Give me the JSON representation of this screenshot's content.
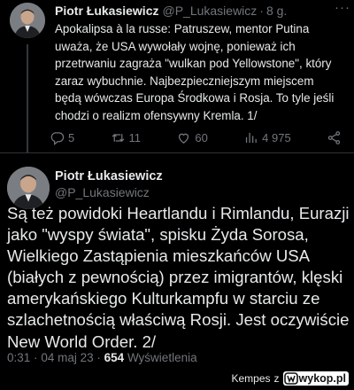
{
  "tweet1": {
    "author_name": "Piotr Łukasiewicz",
    "handle": "@P_Lukasiewicz",
    "separator": "·",
    "time": "8 g.",
    "text": "Apokalipsa à la russe: Patruszew, mentor Putina\nuważa, że USA wywołały wojnę, ponieważ ich\nprzetrwaniu zagraża \"wulkan pod Yellowstone\", który\nzaraz wybuchnie. Najbezpieczniejszym miejscem\nbędą wówczas Europa Środkowa i Rosja. To tyle jeśli\nchodzi o realizm ofensywny Kremla. 1/",
    "replies": "5",
    "retweets": "11",
    "likes": "60",
    "views": "4 975",
    "icons": [
      "reply-icon",
      "retweet-icon",
      "like-icon",
      "views-icon",
      "share-icon",
      "more-icon"
    ]
  },
  "tweet2": {
    "author_name": "Piotr Łukasiewicz",
    "handle": "@P_Lukasiewicz",
    "text": "Są też powidoki Heartlandu i Rimlandu, Eurazji\njako \"wyspy świata\", spisku Żyda Sorosa,\nWielkiego Zastąpienia mieszkańców USA\n(białych z pewnością) przez imigrantów, klęski\namerykańskiego Kulturkampfu w starciu ze\nszlachetnością właściwą Rosji. Jest oczywiście\nNew World Order. 2/",
    "time": "0:31",
    "date": "04 maj 23",
    "separator": "·",
    "views_count": "654",
    "views_label": "Wyświetlenia"
  },
  "watermark": {
    "user": "Kempes",
    "joiner": "z",
    "site": "wykop.pl"
  },
  "colors": {
    "background": "#000000",
    "text": "#e7e9ea",
    "muted": "#71767b",
    "divider": "#2f3336"
  }
}
